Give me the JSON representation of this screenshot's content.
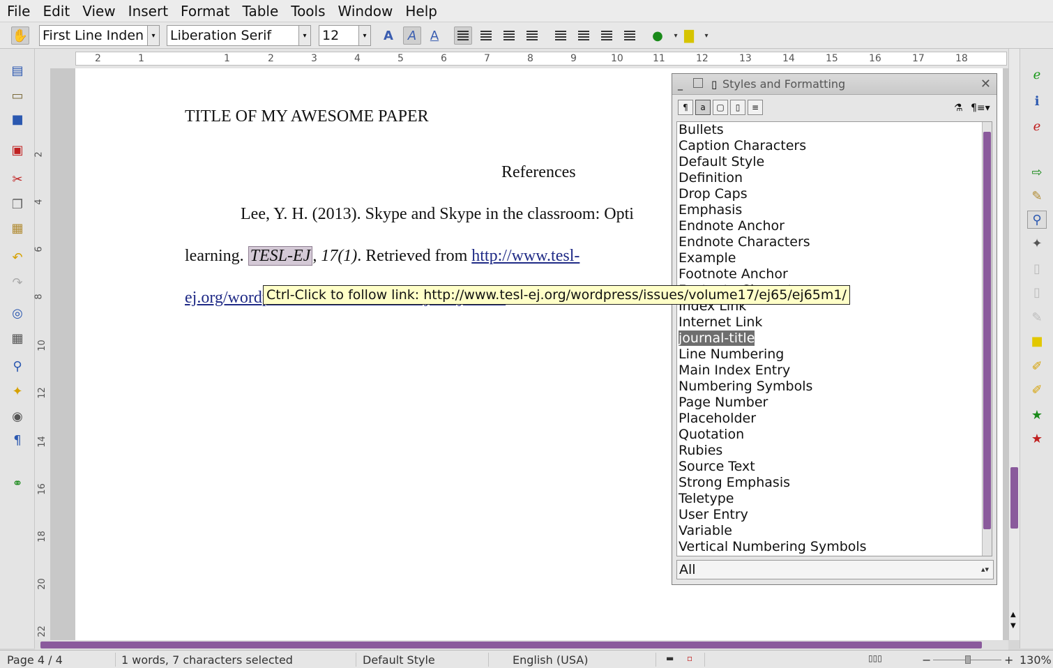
{
  "menu": [
    "File",
    "Edit",
    "View",
    "Insert",
    "Format",
    "Table",
    "Tools",
    "Window",
    "Help"
  ],
  "toolbar": {
    "paragraph_style": "First Line Inden",
    "font_name": "Liberation Serif",
    "font_size": "12"
  },
  "ruler": {
    "h_numbers": [
      "2",
      "1",
      "1",
      "2",
      "3",
      "4",
      "5",
      "6",
      "7",
      "8",
      "9",
      "10",
      "11",
      "12",
      "13",
      "14",
      "15",
      "16",
      "17",
      "18"
    ],
    "v_numbers": [
      "2",
      "4",
      "6",
      "8",
      "10",
      "12",
      "14",
      "16",
      "18",
      "20",
      "22"
    ]
  },
  "document": {
    "title": "TITLE OF MY AWESOME PAPER",
    "heading": "References",
    "line1": "Lee, Y. H. (2013). Skype and Skype in the classroom: Opti",
    "line2_pre": "learning. ",
    "line2_selected": "TESL-EJ",
    "line2_mid": ", ",
    "line2_italic": "17(1)",
    "line2_post": ". Retrieved from ",
    "link_part1": "http://www.tesl-",
    "link_part2": "ej.org/wordpress/issues/volume17/ej65/ej65m1/"
  },
  "tooltip": "Ctrl-Click to follow link: http://www.tesl-ej.org/wordpress/issues/volume17/ej65/ej65m1/",
  "styles_panel": {
    "title": "Styles and Formatting",
    "items": [
      "Bullets",
      "Caption Characters",
      "Default Style",
      "Definition",
      "Drop Caps",
      "Emphasis",
      "Endnote Anchor",
      "Endnote Characters",
      "Example",
      "Footnote Anchor",
      "Footnote Characters",
      "Index Link",
      "Internet Link",
      "journal-title",
      "Line Numbering",
      "Main Index Entry",
      "Numbering Symbols",
      "Page Number",
      "Placeholder",
      "Quotation",
      "Rubies",
      "Source Text",
      "Strong Emphasis",
      "Teletype",
      "User Entry",
      "Variable",
      "Vertical Numbering Symbols"
    ],
    "selected": "journal-title",
    "filter": "All"
  },
  "status": {
    "page": "Page 4 / 4",
    "words": "1 words, 7 characters selected",
    "style": "Default Style",
    "language": "English (USA)",
    "zoom": "130%"
  },
  "colors": {
    "accent": "#8a5a9c",
    "link": "#1f2a86",
    "tooltip_bg": "#ffffc8",
    "selection": "#d4c9d6"
  }
}
